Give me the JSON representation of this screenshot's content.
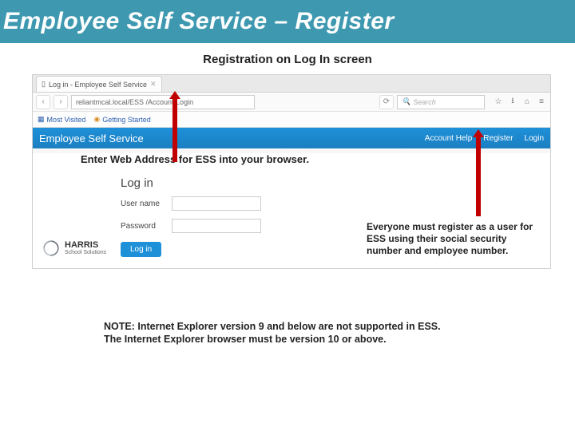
{
  "slide": {
    "title": "Employee Self Service – Register",
    "subtitle": "Registration on Log In screen"
  },
  "browser": {
    "tab_title": "Log in - Employee Self Service",
    "url": "reliantmcal.local/ESS    /Account/Login",
    "search_placeholder": "Search",
    "bookmarks": {
      "most_visited": "Most Visited",
      "getting_started": "Getting Started"
    },
    "nav": {
      "back": "‹",
      "fwd": "›",
      "refresh": "⟳"
    },
    "search_icon": "🔍"
  },
  "app_header": {
    "brand": "Employee Self Service",
    "links": {
      "account_help": "Account Help",
      "register": "Register",
      "login": "Login"
    }
  },
  "callouts": {
    "enter_url": "Enter Web Address for ESS into your browser.",
    "register_note": "Everyone must register as a user for ESS using their social security number and employee number."
  },
  "login_form": {
    "heading": "Log in",
    "username_label": "User name",
    "password_label": "Password",
    "button": "Log in"
  },
  "logo": {
    "name": "HARRIS",
    "sub": "School Solutions"
  },
  "footer_note": {
    "line1": "NOTE:  Internet Explorer version 9 and below are not supported in ESS.",
    "line2": "The Internet Explorer browser must be version 10 or above."
  }
}
